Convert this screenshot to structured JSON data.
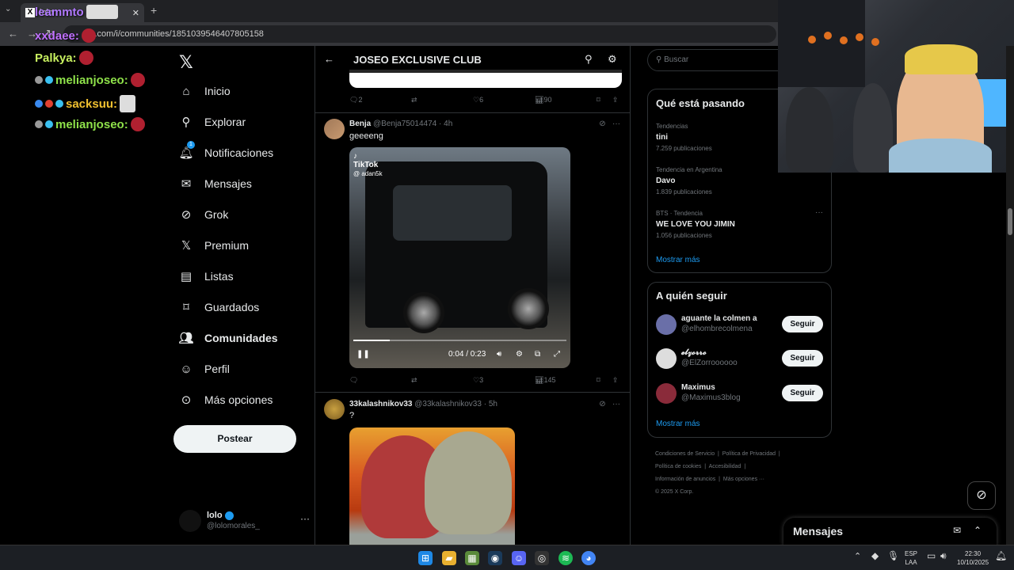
{
  "browser": {
    "tab_title": "lolo",
    "url": "x.com/i/communities/1851039546407805158"
  },
  "chat": [
    {
      "user": "leammto",
      "color": "#b078ff"
    },
    {
      "user": "xxdaee:",
      "color": "#c070ff"
    },
    {
      "user": "Palkya:",
      "color": "#c8f060"
    },
    {
      "user": "melianjoseo:",
      "color": "#8fe24a"
    },
    {
      "user": "sacksuu:",
      "color": "#f0c030"
    },
    {
      "user": "melianjoseo:",
      "color": "#8fe24a"
    }
  ],
  "nav": [
    {
      "label": "Inicio",
      "icon": "home-icon"
    },
    {
      "label": "Explorar",
      "icon": "search-icon"
    },
    {
      "label": "Notificaciones",
      "icon": "bell-icon",
      "badge": "1"
    },
    {
      "label": "Mensajes",
      "icon": "mail-icon"
    },
    {
      "label": "Grok",
      "icon": "grok-icon"
    },
    {
      "label": "Premium",
      "icon": "x-icon"
    },
    {
      "label": "Listas",
      "icon": "list-icon"
    },
    {
      "label": "Guardados",
      "icon": "bookmark-icon"
    },
    {
      "label": "Comunidades",
      "icon": "communities-icon",
      "active": true
    },
    {
      "label": "Perfil",
      "icon": "person-icon"
    },
    {
      "label": "Más opciones",
      "icon": "more-circle-icon"
    }
  ],
  "post_button": "Postear",
  "account": {
    "name": "lolo",
    "handle": "@lolomorales_"
  },
  "community": {
    "title": "JOSEO EXCLUSIVE CLUB"
  },
  "prev_actions": {
    "replies": "2",
    "likes": "6",
    "views": "90"
  },
  "tweets": [
    {
      "name": "Benja",
      "handle": "@Benja75014474",
      "time": "· 4h",
      "text": "geeeeng",
      "video": {
        "time": "0:04 / 0:23",
        "progress": 0.17,
        "watermark": "TikTok",
        "watermark_user": "@ adan5k"
      },
      "actions": {
        "replies": "",
        "retweets": "",
        "likes": "3",
        "views": "145"
      }
    },
    {
      "name": "33kalashnikov33",
      "handle": "@33kalashnikov33",
      "time": "· 5h",
      "text": "?"
    }
  ],
  "search": {
    "placeholder": "Buscar"
  },
  "trends": {
    "title": "Qué está pasando",
    "items": [
      {
        "context": "Tendencias",
        "name": "tini",
        "count": "7.259 publicaciones"
      },
      {
        "context": "Tendencia en Argentina",
        "name": "Davo",
        "count": "1.839 publicaciones"
      },
      {
        "context": "BTS · Tendencia",
        "name": "WE LOVE YOU JIMIN",
        "count": "1.056 publicaciones"
      }
    ],
    "show_more": "Mostrar más"
  },
  "who_to_follow": {
    "title": "A quién seguir",
    "items": [
      {
        "name": "aguante la colmen a",
        "handle": "@elhombrecolmena",
        "button": "Seguir",
        "color": "#6a6fa8"
      },
      {
        "name": "𝓮𝓵𝔃𝓸𝓻𝓻𝓸",
        "handle": "@ElZorroooooo",
        "button": "Seguir",
        "color": "#ddd"
      },
      {
        "name": "Maximus",
        "handle": "@Maximus3blog",
        "button": "Seguir",
        "color": "#8a2b3a"
      }
    ],
    "show_more": "Mostrar más"
  },
  "footer": [
    "Condiciones de Servicio",
    "Política de Privacidad",
    "Política de cookies",
    "Accesibilidad",
    "Información de anuncios",
    "Más opciones ···",
    "© 2025 X Corp."
  ],
  "messages": {
    "title": "Mensajes"
  },
  "taskbar": {
    "lang": "ESP",
    "lang2": "LAA",
    "time": "22:30",
    "date": "10/10/2025"
  }
}
